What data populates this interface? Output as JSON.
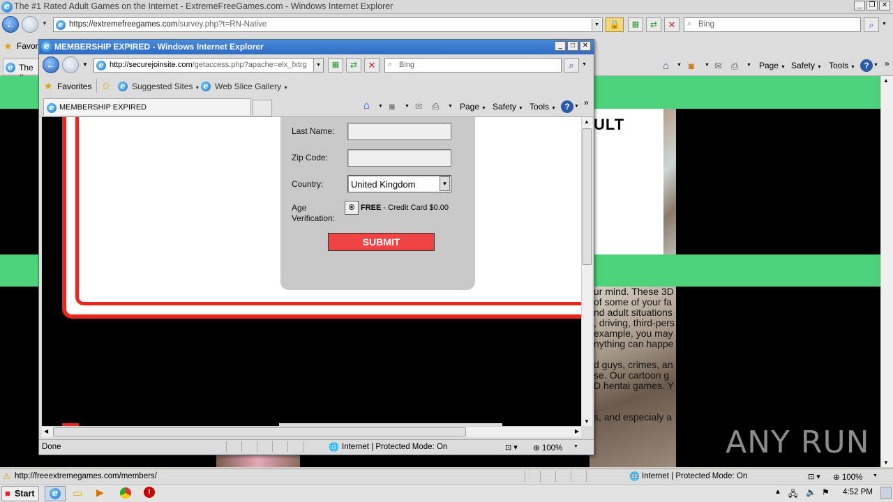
{
  "main_window": {
    "title": "The #1 Rated Adult Games on the Internet - ExtremeFreeGames.com - Windows Internet Explorer",
    "url_domain": "https://extremefreegames.com",
    "url_path": "/survey.php?t=RN-Native",
    "search_placeholder": "Bing",
    "favorites_label": "Favori",
    "tab_label": "The #",
    "toolbar": {
      "page": "Page",
      "safety": "Safety",
      "tools": "Tools"
    },
    "heading_fragment": "ULT",
    "paragraph_lines": [
      "ur mind. These 3D",
      "of some of your fa",
      "nd adult situations",
      ", driving, third-pers",
      "example, you may",
      "nything can happe",
      "",
      "d guys, crimes, an",
      "se. Our cartoon g",
      "D hentai games. Y",
      "",
      "",
      "s, and especialy a"
    ],
    "status_url": "http://freeextremegames.com/members/",
    "status_zone": "Internet | Protected Mode: On",
    "zoom": "100%"
  },
  "popup": {
    "title": "MEMBERSHIP EXPIRED - Windows Internet Explorer",
    "url_domain": "http://securejoinsite.com",
    "url_path": "/getaccess.php?apache=elx_fxtrg",
    "search_placeholder": "Bing",
    "favorites_label": "Favorites",
    "suggested_sites": "Suggested Sites",
    "web_slice_gallery": "Web Slice Gallery",
    "tab_label": "MEMBERSHIP EXPIRED",
    "toolbar": {
      "page": "Page",
      "safety": "Safety",
      "tools": "Tools"
    },
    "form": {
      "last_name_label": "Last Name:",
      "zip_label": "Zip Code:",
      "country_label": "Country:",
      "country_value": "United Kingdom",
      "age_label_1": "Age",
      "age_label_2": "Verification:",
      "age_option_bold": "FREE",
      "age_option_rest": " - Credit Card $0.00",
      "submit_label": "SUBMIT"
    },
    "status_text": "Done",
    "status_zone": "Internet | Protected Mode: On",
    "zoom": "100%"
  },
  "taskbar": {
    "start_label": "Start",
    "clock": "4:52 PM"
  },
  "watermark": "ANY RUN",
  "colors": {
    "page_green": "#4cd27a",
    "submit_red": "#f04444",
    "frame_red": "#e8281e",
    "ie_blue": "#2d6bc4"
  }
}
